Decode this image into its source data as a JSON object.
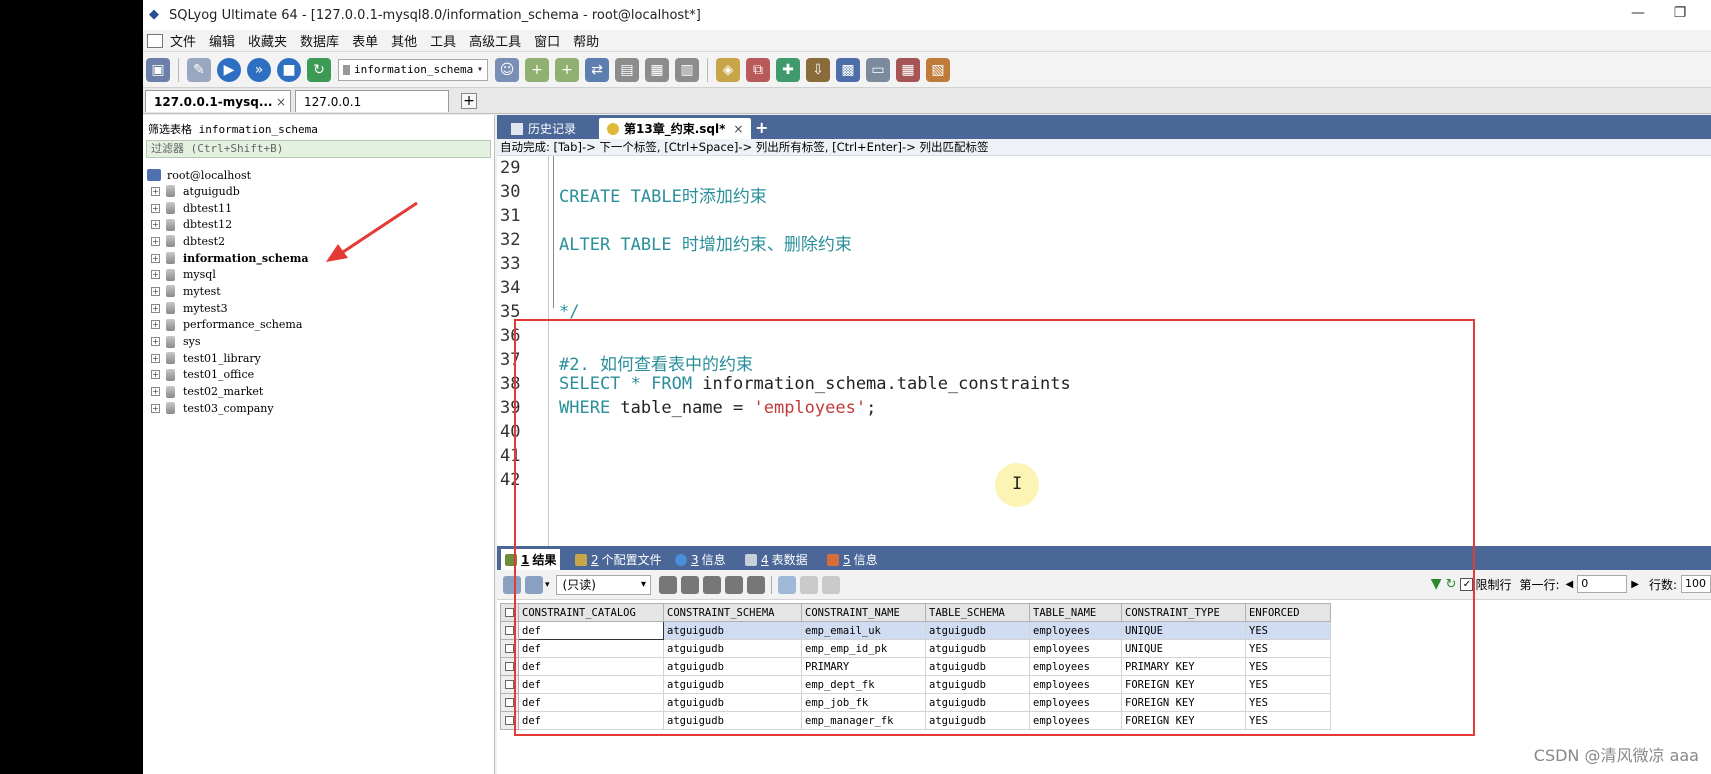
{
  "window": {
    "title": "SQLyog Ultimate 64 - [127.0.0.1-mysql8.0/information_schema - root@localhost*]"
  },
  "menu": [
    "文件",
    "编辑",
    "收藏夹",
    "数据库",
    "表单",
    "其他",
    "工具",
    "高级工具",
    "窗口",
    "帮助"
  ],
  "toolbar": {
    "database_select": "information_schema"
  },
  "connection_tabs": [
    {
      "label": "127.0.0.1-mysq...",
      "close": "×"
    },
    {
      "label": "127.0.0.1"
    }
  ],
  "left_panel": {
    "filter_label": "筛选表格 information_schema",
    "filter_placeholder": "过滤器 (Ctrl+Shift+B)",
    "root": "root@localhost",
    "databases": [
      "atguigudb",
      "dbtest11",
      "dbtest12",
      "dbtest2",
      "information_schema",
      "mysql",
      "mytest",
      "mytest3",
      "performance_schema",
      "sys",
      "test01_library",
      "test01_office",
      "test02_market",
      "test03_company"
    ],
    "selected": "information_schema"
  },
  "query_tabs": [
    {
      "label": "历史记录"
    },
    {
      "label": "第13章_约束.sql*",
      "close": "×"
    }
  ],
  "hint": "自动完成: [Tab]-> 下一个标签, [Ctrl+Space]-> 列出所有标签, [Ctrl+Enter]-> 列出匹配标签",
  "editor": {
    "line_numbers": [
      "29",
      "30",
      "31",
      "32",
      "33",
      "34",
      "35",
      "36",
      "37",
      "38",
      "39",
      "40",
      "41",
      "42"
    ],
    "line30": "CREATE TABLE时添加约束",
    "line32": "ALTER TABLE 时增加约束、删除约束",
    "line35": "*/",
    "line37": "#2. 如何查看表中的约束",
    "line38_kw1": "SELECT * FROM",
    "line38_rest": " information_schema.table_constraints",
    "line39_kw": "WHERE",
    "line39_mid": " table_name = ",
    "line39_str": "'employees'",
    "line39_end": ";"
  },
  "result_tabs": [
    {
      "num": "1",
      "label": "结果"
    },
    {
      "num": "2",
      "label": "个配置文件"
    },
    {
      "num": "3",
      "label": "信息"
    },
    {
      "num": "4",
      "label": "表数据"
    },
    {
      "num": "5",
      "label": "信息"
    }
  ],
  "result_toolbar": {
    "readonly": "(只读)",
    "limit_label": "限制行",
    "first_row_label": "第一行:",
    "first_row_value": "0",
    "rows_label": "行数:",
    "rows_value": "100"
  },
  "grid": {
    "columns": [
      "CONSTRAINT_CATALOG",
      "CONSTRAINT_SCHEMA",
      "CONSTRAINT_NAME",
      "TABLE_SCHEMA",
      "TABLE_NAME",
      "CONSTRAINT_TYPE",
      "ENFORCED"
    ],
    "rows": [
      [
        "def",
        "atguigudb",
        "emp_email_uk",
        "atguigudb",
        "employees",
        "UNIQUE",
        "YES"
      ],
      [
        "def",
        "atguigudb",
        "emp_emp_id_pk",
        "atguigudb",
        "employees",
        "UNIQUE",
        "YES"
      ],
      [
        "def",
        "atguigudb",
        "PRIMARY",
        "atguigudb",
        "employees",
        "PRIMARY KEY",
        "YES"
      ],
      [
        "def",
        "atguigudb",
        "emp_dept_fk",
        "atguigudb",
        "employees",
        "FOREIGN KEY",
        "YES"
      ],
      [
        "def",
        "atguigudb",
        "emp_job_fk",
        "atguigudb",
        "employees",
        "FOREIGN KEY",
        "YES"
      ],
      [
        "def",
        "atguigudb",
        "emp_manager_fk",
        "atguigudb",
        "employees",
        "FOREIGN KEY",
        "YES"
      ]
    ]
  },
  "watermark": "CSDN @清风微凉 aaa",
  "colors": {
    "tab_bar": "#4a6798",
    "highlight": "#e53935",
    "keyword": "#2a8f9a",
    "string": "#c23a3a"
  }
}
